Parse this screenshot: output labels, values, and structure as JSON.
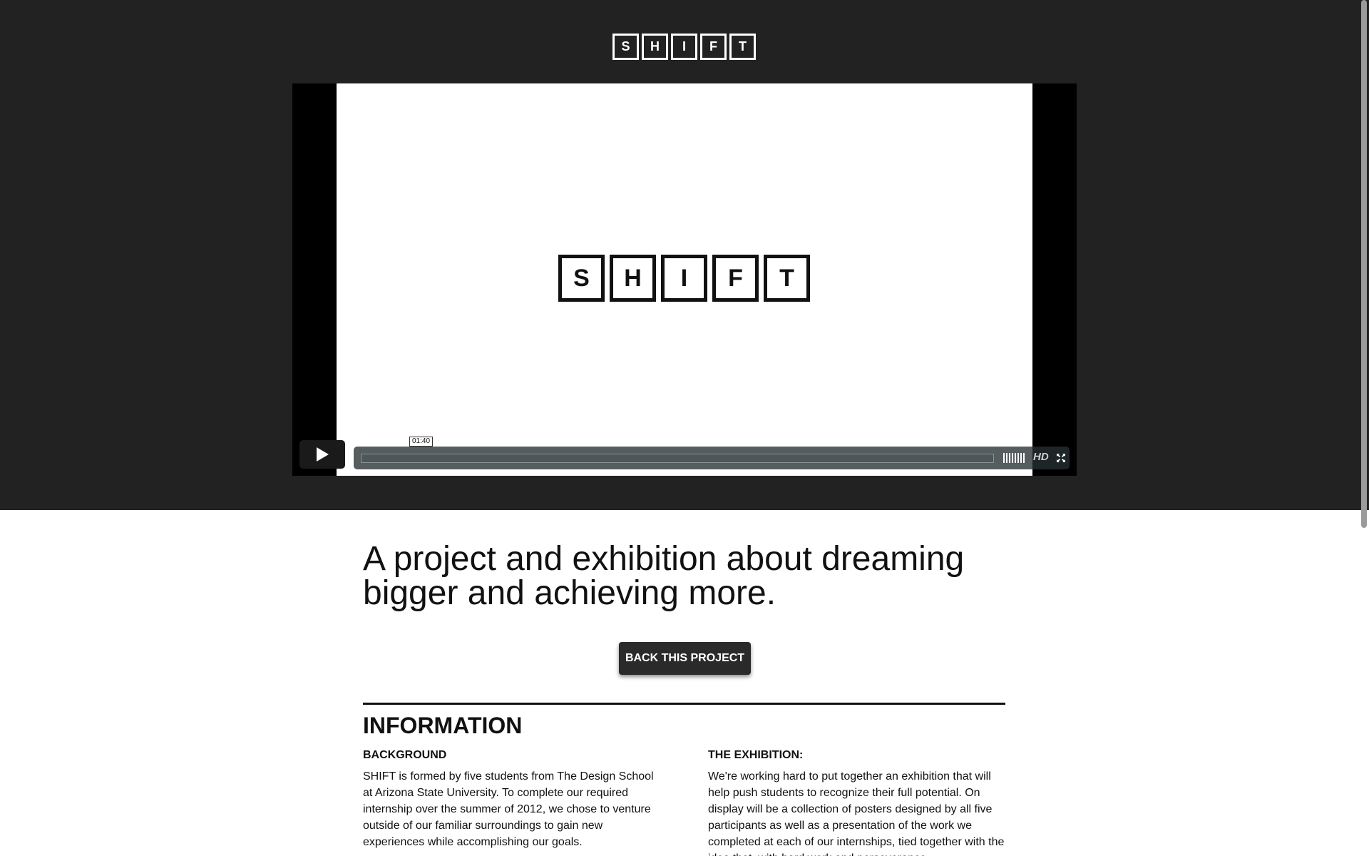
{
  "header": {
    "logo_letters": [
      "S",
      "H",
      "I",
      "F",
      "T"
    ]
  },
  "video": {
    "title_letters": [
      "S",
      "H",
      "I",
      "F",
      "T"
    ],
    "time": "01:40",
    "progress": 0,
    "hd_label": "HD",
    "icons": {
      "play": "play-icon",
      "volume": "volume-icon",
      "fullscreen": "fullscreen-icon"
    }
  },
  "main": {
    "headline": "A project and exhibition about dreaming bigger and achieving more.",
    "back_button": "BACK THIS PROJECT",
    "section_title": "INFORMATION",
    "columns": [
      {
        "heading": "BACKGROUND",
        "body": "SHIFT is formed by five students from The Design School at Arizona State University. To complete our required internship over the summer of 2012, we chose to venture outside of our familiar surroundings to gain new experiences while accomplishing our goals."
      },
      {
        "heading": "THE EXHIBITION:",
        "body": "We're working hard to put together an exhibition that will help push students to recognize their full potential. On display will be a collection of posters designed by all five participants as well as a presentation of the work we completed at each of our internships, tied together with the idea that, with hard work and perseverance,"
      }
    ]
  },
  "colors": {
    "hero_bg": "#222222",
    "button_bg": "#2a2a2a",
    "text": "#111111"
  }
}
